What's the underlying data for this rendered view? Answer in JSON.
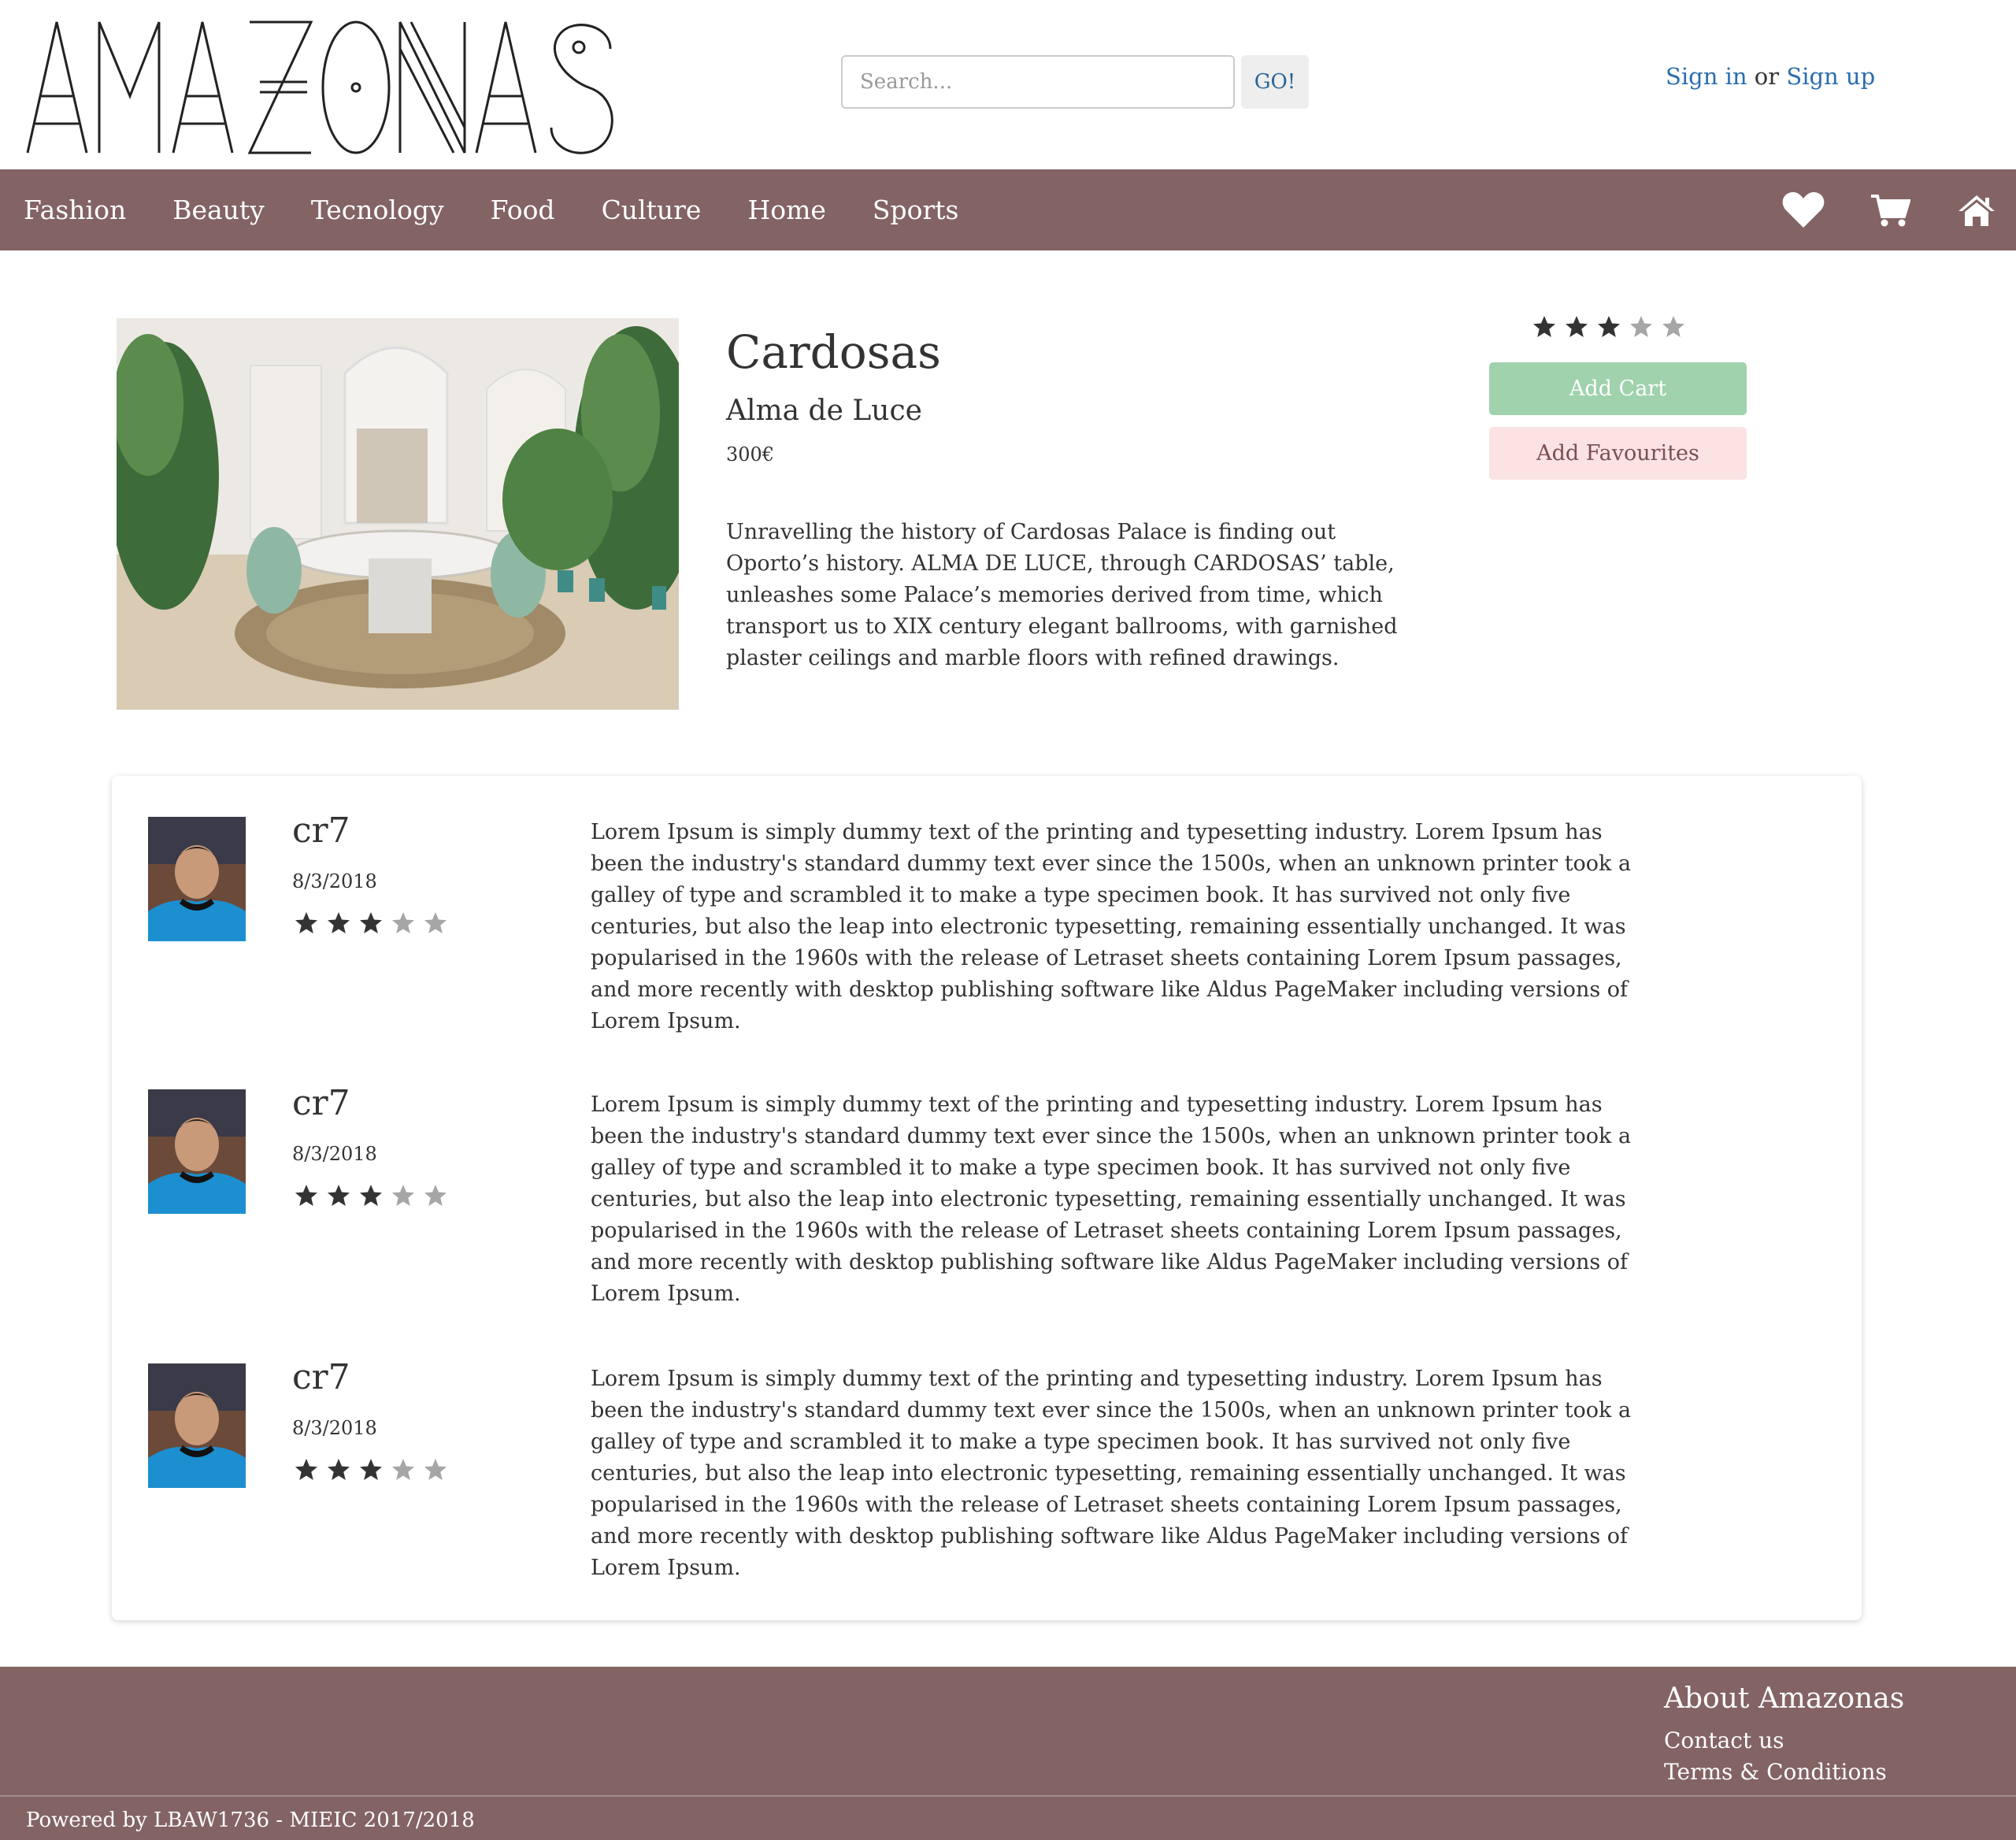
{
  "header": {
    "logo_text": "AMAZONAS",
    "search_placeholder": "Search...",
    "go_label": "GO!",
    "sign_in": "Sign in",
    "or": "or",
    "sign_up": "Sign up"
  },
  "nav": {
    "items": [
      {
        "label": "Fashion"
      },
      {
        "label": "Beauty"
      },
      {
        "label": "Tecnology"
      },
      {
        "label": "Food"
      },
      {
        "label": "Culture"
      },
      {
        "label": "Home"
      },
      {
        "label": "Sports"
      }
    ],
    "icons": [
      "heart-icon",
      "cart-icon",
      "home-icon"
    ]
  },
  "product": {
    "title": "Cardosas",
    "brand": "Alma de Luce",
    "price": "300€",
    "description": "Unravelling the history of Cardosas Palace is finding out Oporto’s history. ALMA DE LUCE, through CARDOSAS’ table, unleashes some Palace’s memories derived from time, which transport us to XIX century elegant ballrooms, with garnished plaster ceilings and marble floors with refined drawings.",
    "rating": 3,
    "rating_max": 5,
    "add_cart_label": "Add Cart",
    "add_favourites_label": "Add Favourites"
  },
  "reviews": [
    {
      "user": "cr7",
      "date": "8/3/2018",
      "rating": 3,
      "text": "Lorem Ipsum is simply dummy text of the printing and typesetting industry. Lorem Ipsum has been the industry's standard dummy text ever since the 1500s, when an unknown printer took a galley of type and scrambled it to make a type specimen book. It has survived not only five centuries, but also the leap into electronic typesetting, remaining essentially unchanged. It was popularised in the 1960s with the release of Letraset sheets containing Lorem Ipsum passages, and more recently with desktop publishing software like Aldus PageMaker including versions of Lorem Ipsum."
    },
    {
      "user": "cr7",
      "date": "8/3/2018",
      "rating": 3,
      "text": "Lorem Ipsum is simply dummy text of the printing and typesetting industry. Lorem Ipsum has been the industry's standard dummy text ever since the 1500s, when an unknown printer took a galley of type and scrambled it to make a type specimen book. It has survived not only five centuries, but also the leap into electronic typesetting, remaining essentially unchanged. It was popularised in the 1960s with the release of Letraset sheets containing Lorem Ipsum passages, and more recently with desktop publishing software like Aldus PageMaker including versions of Lorem Ipsum."
    },
    {
      "user": "cr7",
      "date": "8/3/2018",
      "rating": 3,
      "text": "Lorem Ipsum is simply dummy text of the printing and typesetting industry. Lorem Ipsum has been the industry's standard dummy text ever since the 1500s, when an unknown printer took a galley of type and scrambled it to make a type specimen book. It has survived not only five centuries, but also the leap into electronic typesetting, remaining essentially unchanged. It was popularised in the 1960s with the release of Letraset sheets containing Lorem Ipsum passages, and more recently with desktop publishing software like Aldus PageMaker including versions of Lorem Ipsum."
    }
  ],
  "footer": {
    "about_title": "About Amazonas",
    "contact_us": "Contact us",
    "terms": "Terms & Conditions",
    "powered_by": "Powered by LBAW1736 - MIEIC 2017/2018"
  },
  "colors": {
    "nav_bg": "#836364",
    "link": "#2a6db0",
    "add_cart_bg": "#9fd2ad",
    "add_fav_bg": "#fbe2e3",
    "star_filled": "#333333",
    "star_empty": "#a6a6a6"
  }
}
